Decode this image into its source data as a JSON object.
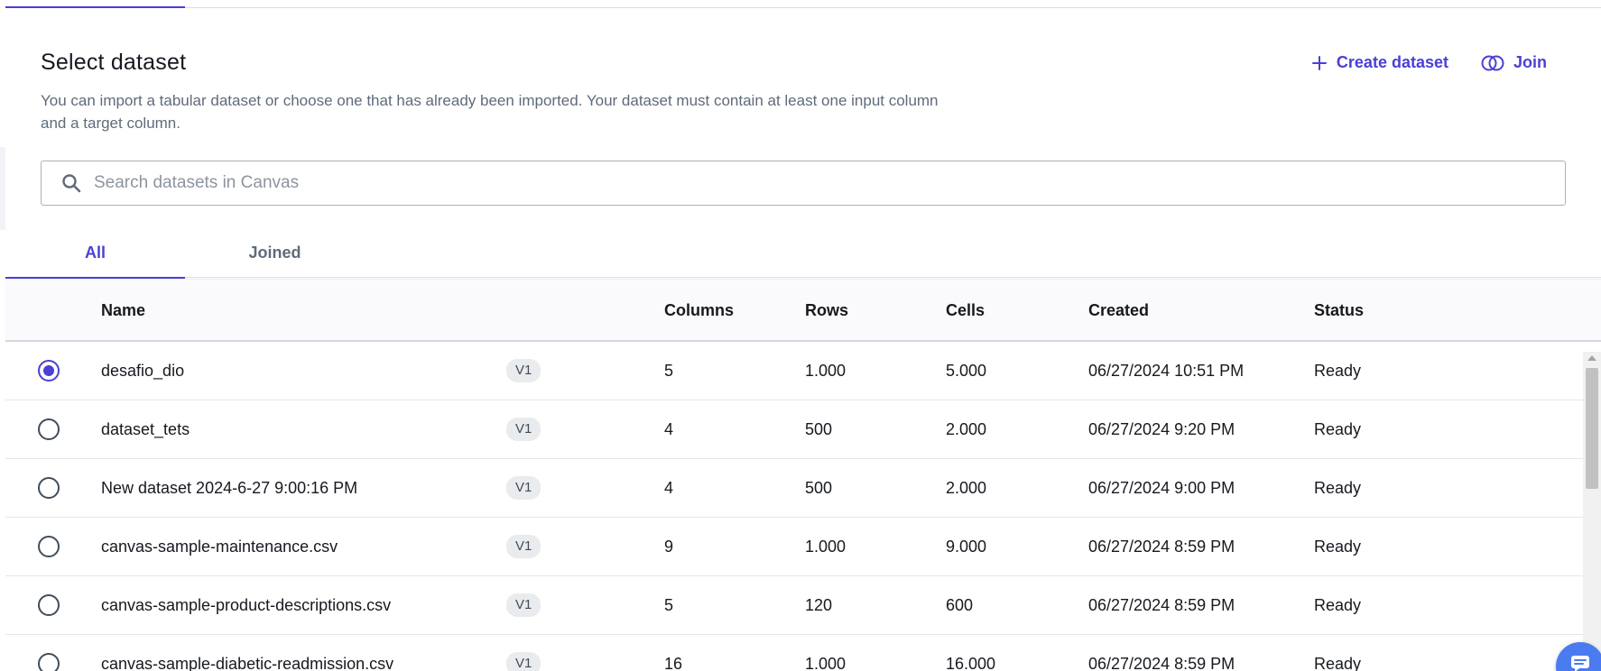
{
  "header": {
    "title": "Select dataset",
    "description_line1": "You can import a tabular dataset or choose one that has already been imported. Your dataset must contain at least one input column",
    "description_line2": "and a target column."
  },
  "actions": {
    "create_label": "Create dataset",
    "join_label": "Join"
  },
  "search": {
    "placeholder": "Search datasets in Canvas",
    "value": ""
  },
  "tabs": {
    "all": "All",
    "joined": "Joined",
    "active": "All"
  },
  "table": {
    "headers": {
      "name": "Name",
      "columns": "Columns",
      "rows": "Rows",
      "cells": "Cells",
      "created": "Created",
      "status": "Status"
    },
    "rows": [
      {
        "selected": true,
        "name": "desafio_dio",
        "version": "V1",
        "columns": "5",
        "rows": "1.000",
        "cells": "5.000",
        "created": "06/27/2024 10:51 PM",
        "status": "Ready"
      },
      {
        "selected": false,
        "name": "dataset_tets",
        "version": "V1",
        "columns": "4",
        "rows": "500",
        "cells": "2.000",
        "created": "06/27/2024 9:20 PM",
        "status": "Ready"
      },
      {
        "selected": false,
        "name": "New dataset 2024-6-27 9:00:16 PM",
        "version": "V1",
        "columns": "4",
        "rows": "500",
        "cells": "2.000",
        "created": "06/27/2024 9:00 PM",
        "status": "Ready"
      },
      {
        "selected": false,
        "name": "canvas-sample-maintenance.csv",
        "version": "V1",
        "columns": "9",
        "rows": "1.000",
        "cells": "9.000",
        "created": "06/27/2024 8:59 PM",
        "status": "Ready"
      },
      {
        "selected": false,
        "name": "canvas-sample-product-descriptions.csv",
        "version": "V1",
        "columns": "5",
        "rows": "120",
        "cells": "600",
        "created": "06/27/2024 8:59 PM",
        "status": "Ready"
      },
      {
        "selected": false,
        "name": "canvas-sample-diabetic-readmission.csv",
        "version": "V1",
        "columns": "16",
        "rows": "1.000",
        "cells": "16.000",
        "created": "06/27/2024 8:59 PM",
        "status": "Ready"
      }
    ]
  },
  "colors": {
    "accent": "#4b3fd6",
    "text": "#16191f",
    "muted": "#5f6b7a"
  },
  "icons": {
    "create": "plus-icon",
    "join": "join-circles-icon",
    "search": "search-icon",
    "chat": "chat-icon"
  }
}
